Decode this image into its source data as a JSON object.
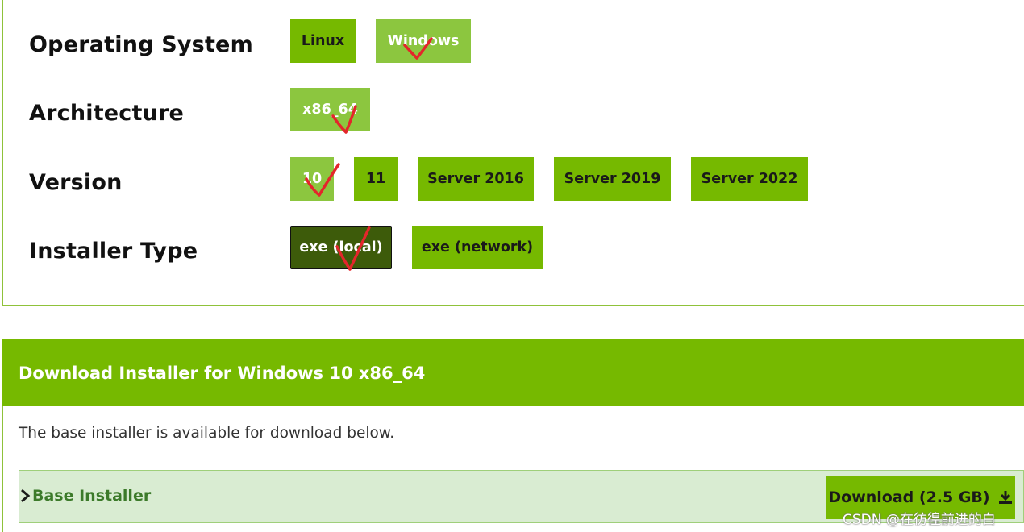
{
  "selector": {
    "rows": [
      {
        "label": "Operating System",
        "options": [
          "Linux",
          "Windows"
        ],
        "selected": "Windows"
      },
      {
        "label": "Architecture",
        "options": [
          "x86_64"
        ],
        "selected": "x86_64"
      },
      {
        "label": "Version",
        "options": [
          "10",
          "11",
          "Server 2016",
          "Server 2019",
          "Server 2022"
        ],
        "selected": "10"
      },
      {
        "label": "Installer Type",
        "options": [
          "exe (local)",
          "exe (network)"
        ],
        "selected": "exe (local)"
      }
    ]
  },
  "download": {
    "title": "Download Installer for Windows 10 x86_64",
    "description": "The base installer is available for download below.",
    "installer_label": "Base Installer",
    "button_label": "Download (2.5 GB)",
    "button_icon": "download-icon",
    "chevron_icon": "chevron-right-icon"
  },
  "watermark": "CSDN @在彷徨前进的白",
  "colors": {
    "accent": "#76b900",
    "selected_light": "#8cc63f",
    "selected_dark": "#3d5b0a",
    "installer_bg": "#d9ecd2",
    "check_mark": "#e3262b"
  }
}
